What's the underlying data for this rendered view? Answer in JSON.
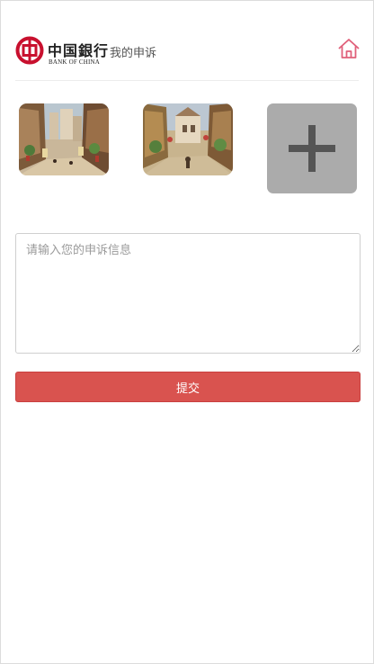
{
  "header": {
    "logo_name": "中国銀行",
    "logo_en": "BANK OF CHINA",
    "title": "我的申诉",
    "home_icon": "home-icon"
  },
  "photos": [
    {
      "icon": "street-photo-1"
    },
    {
      "icon": "street-photo-2"
    }
  ],
  "add_photo": {
    "icon": "plus-icon"
  },
  "form": {
    "placeholder": "请输入您的申诉信息",
    "value": ""
  },
  "submit_label": "提交",
  "colors": {
    "brand_red": "#c8102e",
    "submit_bg": "#d9534f",
    "add_bg": "#ababab",
    "home_icon": "#e0607a"
  }
}
